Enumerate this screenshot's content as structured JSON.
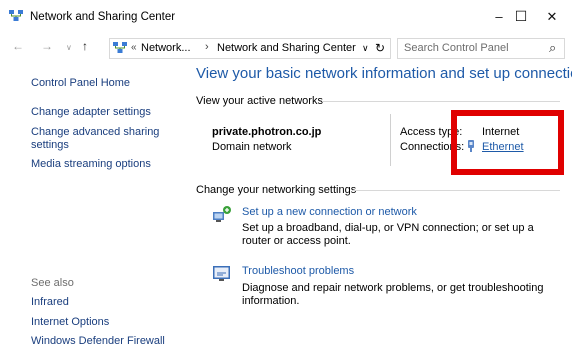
{
  "window": {
    "title": "Network and Sharing Center",
    "minimize_glyph": "–",
    "maximize_glyph": "☐",
    "close_glyph": "✕"
  },
  "address_bar": {
    "back_glyph": "←",
    "forward_glyph": "→",
    "recent_glyph": "∨",
    "up_glyph": "↑",
    "chevron": "«",
    "crumb1": "Network...",
    "separator": "›",
    "crumb2": "Network and Sharing Center",
    "dropdown_glyph": "∨",
    "refresh_glyph": "↻",
    "search_placeholder": "Search Control Panel",
    "search_glyph": "⌕"
  },
  "sidebar": {
    "home": "Control Panel Home",
    "links": [
      "Change adapter settings",
      "Change advanced sharing settings",
      "Media streaming options"
    ],
    "see_also": "See also",
    "see_also_links": [
      "Infrared",
      "Internet Options",
      "Windows Defender Firewall"
    ]
  },
  "main": {
    "heading": "View your basic network information and set up connections",
    "active_networks_label": "View your active networks",
    "network_name": "private.photron.co.jp",
    "network_type": "Domain network",
    "access_type_label": "Access type:",
    "access_type_value": "Internet",
    "connections_label": "Connections:",
    "connections_value": "Ethernet",
    "change_settings_label": "Change your networking settings",
    "tasks": [
      {
        "title": "Set up a new connection or network",
        "description": "Set up a broadband, dial-up, or VPN connection; or set up a router or access point."
      },
      {
        "title": "Troubleshoot problems",
        "description": "Diagnose and repair network problems, or get troubleshooting information."
      }
    ]
  },
  "colors": {
    "link": "#1e5aa8",
    "highlight_box": "#e00000"
  }
}
